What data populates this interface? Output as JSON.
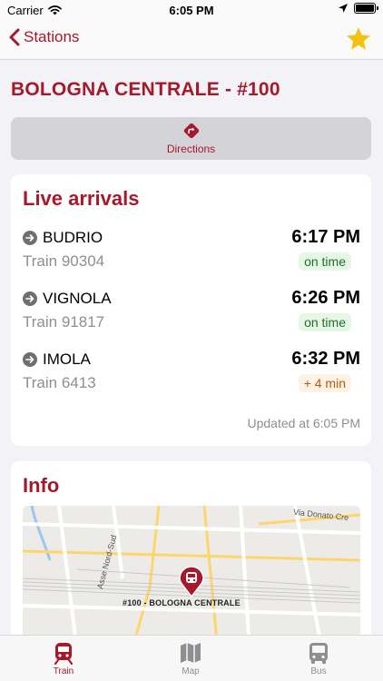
{
  "status_bar": {
    "carrier": "Carrier",
    "time": "6:05 PM"
  },
  "nav": {
    "back_label": "Stations"
  },
  "station": {
    "title": "BOLOGNA CENTRALE - #100"
  },
  "directions": {
    "label": "Directions"
  },
  "arrivals": {
    "title": "Live arrivals",
    "items": [
      {
        "destination": "BUDRIO",
        "train": "Train 90304",
        "time": "6:17 PM",
        "status": "on time"
      },
      {
        "destination": "VIGNOLA",
        "train": "Train 91817",
        "time": "6:26 PM",
        "status": "on time"
      },
      {
        "destination": "IMOLA",
        "train": "Train 6413",
        "time": "6:32 PM",
        "status": "+ 4 min"
      }
    ],
    "updated": "Updated at 6:05 PM"
  },
  "info": {
    "title": "Info",
    "map": {
      "street_1": "Via Donato Cre",
      "street_2": "Asse Nord-Sud",
      "station_label": "#100 - BOLOGNA CENTRALE"
    }
  },
  "tabs": [
    {
      "label": "Train"
    },
    {
      "label": "Map"
    },
    {
      "label": "Bus"
    }
  ],
  "colors": {
    "accent": "#a5192a",
    "star": "#f4c20d",
    "on_time_bg": "#e6f7e6",
    "late_bg": "#fdf2e4"
  }
}
